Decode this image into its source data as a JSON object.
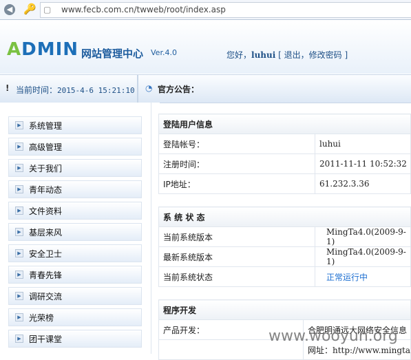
{
  "browser": {
    "url": "www.fecb.com.cn/twweb/root/index.asp"
  },
  "header": {
    "logo": "ADMIN",
    "title_cn": "网站管理中心",
    "version": "Ver.4.0",
    "greeting": "您好，",
    "user": "luhui",
    "logout": "退出",
    "change_pw": "修改密码"
  },
  "bar": {
    "time_label": "当前时间：",
    "time": "2015-4-6 15:21:10",
    "notice": "官方公告："
  },
  "menu": [
    {
      "label": "系统管理"
    },
    {
      "label": "高级管理"
    },
    {
      "label": "关于我们"
    },
    {
      "label": "青年动态"
    },
    {
      "label": "文件资料"
    },
    {
      "label": "基层来风"
    },
    {
      "label": "安全卫士"
    },
    {
      "label": "青春先锋"
    },
    {
      "label": "调研交流"
    },
    {
      "label": "光荣榜"
    },
    {
      "label": "团干课堂"
    }
  ],
  "login_info": {
    "title": "登陆用户信息",
    "rows": [
      {
        "k": "登陆帐号：",
        "v": "luhui"
      },
      {
        "k": "注册时间：",
        "v": "2011-11-11 10:52:32"
      },
      {
        "k": "IP地址：",
        "v": "61.232.3.36"
      }
    ]
  },
  "system_status": {
    "title": "系 统 状 态",
    "rows": [
      {
        "k": "当前系统版本",
        "v": "MingTa4.0(2009-9-1)"
      },
      {
        "k": "最新系统版本",
        "v": "MingTa4.0(2009-9-1)"
      },
      {
        "k": "当前系统状态",
        "v": "正常运行中"
      }
    ]
  },
  "dev": {
    "title": "程序开发",
    "rows": [
      {
        "k": "产品开发：",
        "v": "合肥明通远大网络安全信息"
      },
      {
        "k": "",
        "v": "网址：http://www.mingta"
      }
    ]
  },
  "watermark": "www.wooyun.org",
  "colors": {
    "accent": "#1d6fb8",
    "status": "#1d6fd1"
  }
}
